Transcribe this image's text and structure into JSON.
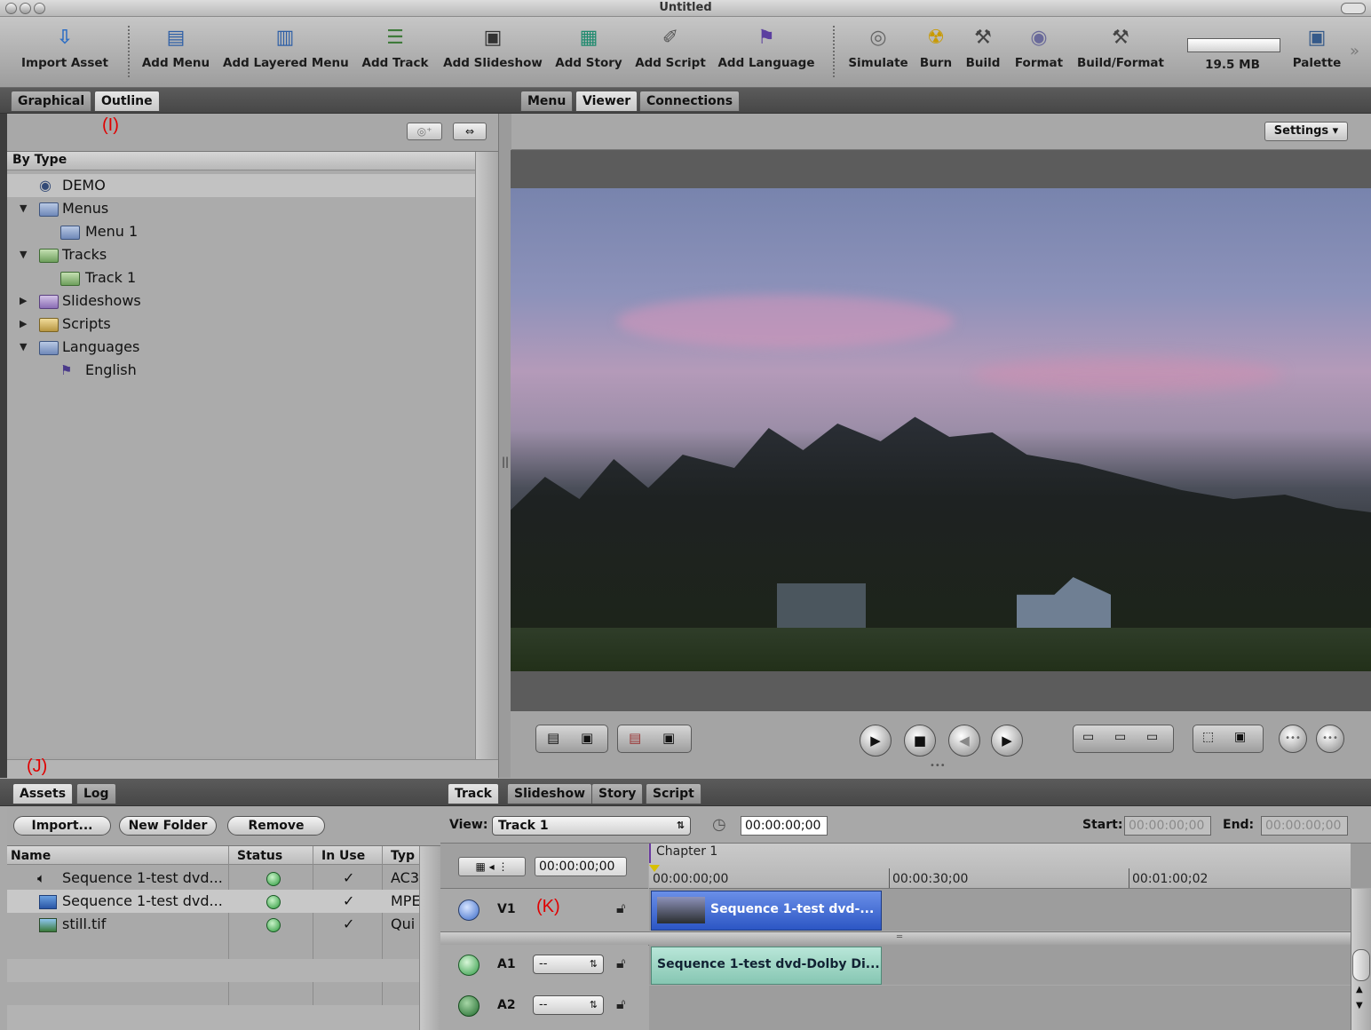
{
  "window": {
    "title": "Untitled"
  },
  "toolbar": {
    "items": [
      {
        "label": "Import Asset",
        "icon": "import-asset-icon"
      },
      {
        "label": "Add Menu",
        "icon": "add-menu-icon"
      },
      {
        "label": "Add Layered Menu",
        "icon": "add-layered-menu-icon"
      },
      {
        "label": "Add Track",
        "icon": "add-track-icon"
      },
      {
        "label": "Add Slideshow",
        "icon": "add-slideshow-icon"
      },
      {
        "label": "Add Story",
        "icon": "add-story-icon"
      },
      {
        "label": "Add Script",
        "icon": "add-script-icon"
      },
      {
        "label": "Add Language",
        "icon": "add-language-icon"
      },
      {
        "label": "Simulate",
        "icon": "simulate-icon"
      },
      {
        "label": "Burn",
        "icon": "burn-icon"
      },
      {
        "label": "Build",
        "icon": "build-icon"
      },
      {
        "label": "Format",
        "icon": "format-icon"
      },
      {
        "label": "Build/Format",
        "icon": "build-format-icon"
      },
      {
        "label": "19.5 MB",
        "icon": "disk-usage-meter"
      },
      {
        "label": "Palette",
        "icon": "palette-icon"
      }
    ],
    "overflow_glyph": "»"
  },
  "left_tabs": {
    "tabs": [
      "Graphical",
      "Outline"
    ],
    "active": "Outline"
  },
  "outline": {
    "marker": "(I)",
    "header": "By Type",
    "items": [
      {
        "label": "DEMO",
        "level": 0,
        "icon": "disc-icon"
      },
      {
        "label": "Menus",
        "level": 0,
        "icon": "folder-icon",
        "expanded": true
      },
      {
        "label": "Menu 1",
        "level": 1,
        "icon": "menu-icon"
      },
      {
        "label": "Tracks",
        "level": 0,
        "icon": "folder-icon",
        "expanded": true
      },
      {
        "label": "Track 1",
        "level": 1,
        "icon": "track-icon"
      },
      {
        "label": "Slideshows",
        "level": 0,
        "icon": "folder-icon",
        "expanded": false
      },
      {
        "label": "Scripts",
        "level": 0,
        "icon": "folder-icon",
        "expanded": false
      },
      {
        "label": "Languages",
        "level": 0,
        "icon": "folder-icon",
        "expanded": true
      },
      {
        "label": "English",
        "level": 1,
        "icon": "language-flag-icon"
      }
    ]
  },
  "viewer_tabs": {
    "tabs": [
      "Menu",
      "Viewer",
      "Connections"
    ],
    "active": "Viewer"
  },
  "viewer": {
    "settings_label": "Settings ▾"
  },
  "assets_tabs": {
    "marker": "(J)",
    "tabs": [
      "Assets",
      "Log"
    ],
    "active": "Assets"
  },
  "assets": {
    "buttons": {
      "import": "Import...",
      "new_folder": "New Folder",
      "remove": "Remove"
    },
    "columns": [
      "Name",
      "Status",
      "In Use",
      "Typ"
    ],
    "rows": [
      {
        "name": "Sequence 1-test dvd...",
        "status": "ok",
        "in_use": "✓",
        "type": "AC3",
        "icon": "audio-icon"
      },
      {
        "name": "Sequence 1-test dvd...",
        "status": "ok",
        "in_use": "✓",
        "type": "MPE",
        "icon": "video-icon"
      },
      {
        "name": "still.tif",
        "status": "ok",
        "in_use": "✓",
        "type": "Qui",
        "icon": "image-icon"
      }
    ]
  },
  "timeline_tabs": {
    "tabs": [
      "Track",
      "Slideshow",
      "Story",
      "Script"
    ],
    "active": "Track"
  },
  "timeline": {
    "view_label": "View:",
    "view_value": "Track 1",
    "timecode": "00:00:00;00",
    "start_label": "Start:",
    "start_value": "00:00:00;00",
    "end_label": "End:",
    "end_value": "00:00:00;00",
    "playhead_timecode": "00:00:00;00",
    "chapter": "Chapter 1",
    "ruler": [
      "00:00:00;00",
      "00:00:30;00",
      "00:01:00;02"
    ],
    "lanes": [
      {
        "id": "V1",
        "marker": "(K)",
        "clip": "Sequence 1-test dvd-..."
      },
      {
        "id": "A1",
        "stepper": "--",
        "clip": "Sequence 1-test dvd-Dolby Di..."
      },
      {
        "id": "A2",
        "stepper": "--",
        "clip": ""
      }
    ]
  }
}
